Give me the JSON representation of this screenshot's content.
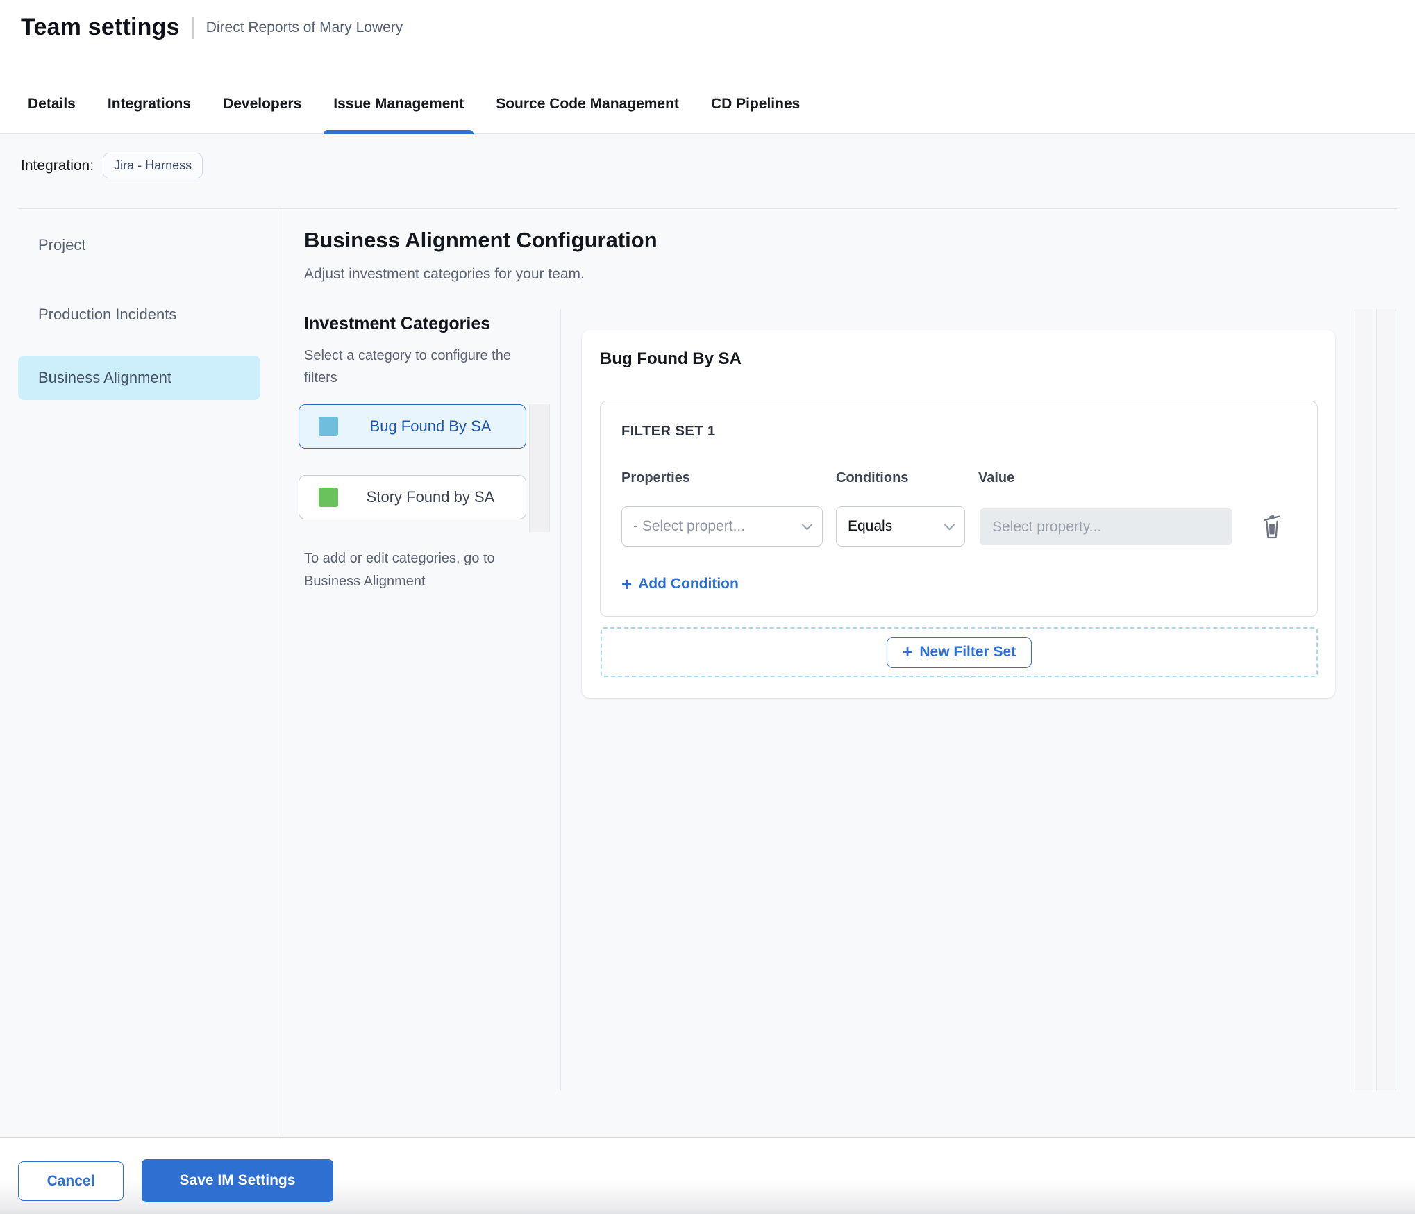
{
  "header": {
    "title": "Team settings",
    "subtitle": "Direct Reports of Mary Lowery"
  },
  "tabs": [
    {
      "label": "Details",
      "active": false
    },
    {
      "label": "Integrations",
      "active": false
    },
    {
      "label": "Developers",
      "active": false
    },
    {
      "label": "Issue Management",
      "active": true
    },
    {
      "label": "Source Code Management",
      "active": false
    },
    {
      "label": "CD Pipelines",
      "active": false
    }
  ],
  "integration": {
    "label": "Integration:",
    "chip": "Jira - Harness"
  },
  "sidebar": {
    "items": [
      {
        "label": "Project",
        "selected": false
      },
      {
        "label": "Production Incidents",
        "selected": false
      },
      {
        "label": "Business Alignment",
        "selected": true
      }
    ],
    "selected_bg": "#cdeffc"
  },
  "main": {
    "title": "Business Alignment Configuration",
    "subtitle": "Adjust investment categories for your team.",
    "categories": {
      "heading": "Investment Categories",
      "helper": "Select a category to configure the filters",
      "items": [
        {
          "label": "Bug Found By SA",
          "swatch": "#6fbedd",
          "selected": true
        },
        {
          "label": "Story Found by SA",
          "swatch": "#6ac25c",
          "selected": false
        }
      ],
      "footnote": "To add or edit categories, go to Business Alignment"
    },
    "filter_panel": {
      "title": "Bug Found By SA",
      "filter_set_label": "FILTER SET 1",
      "columns": [
        "Properties",
        "Conditions",
        "Value"
      ],
      "property_select_value": "- Select propert...",
      "condition_select_value": "Equals",
      "value_placeholder": "Select property...",
      "add_condition_label": "Add Condition",
      "new_filter_set_label": "New Filter Set"
    }
  },
  "footer": {
    "cancel_label": "Cancel",
    "save_label": "Save IM Settings"
  },
  "icons": {
    "plus": "+"
  },
  "colors": {
    "accent": "#2e6fd2",
    "tab_underline": "#3572d0",
    "selected_category_bg": "#e9f5fc",
    "selected_category_border": "#3668c2",
    "content_bg": "#f8f9fb",
    "dashed_border": "#a8d9ef"
  }
}
